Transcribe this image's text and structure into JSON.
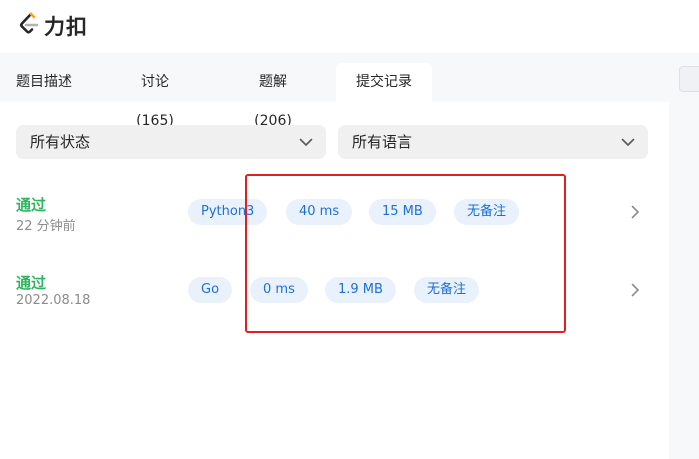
{
  "brand": {
    "name": "力扣",
    "logo_icon": "leetcode-logo-icon",
    "accent": "#ffa116"
  },
  "tabs": [
    {
      "label": "题目描述",
      "active": false
    },
    {
      "label": "讨论 (165)",
      "active": false
    },
    {
      "label": "题解 (206)",
      "active": false
    },
    {
      "label": "提交记录",
      "active": true
    }
  ],
  "filters": {
    "status": {
      "value": "所有状态",
      "icon": "chevron-down-icon"
    },
    "language": {
      "value": "所有语言",
      "icon": "chevron-down-icon"
    }
  },
  "submissions": [
    {
      "status": "通过",
      "time": "22 分钟前",
      "language": "Python3",
      "runtime": "40 ms",
      "memory": "15 MB",
      "note": "无备注"
    },
    {
      "status": "通过",
      "time": "2022.08.18",
      "language": "Go",
      "runtime": "0 ms",
      "memory": "1.9 MB",
      "note": "无备注"
    }
  ],
  "colors": {
    "accepted": "#2db55d",
    "pill_bg": "#e8f1fc",
    "pill_text": "#1f6fd6",
    "highlight": "#e02020"
  }
}
